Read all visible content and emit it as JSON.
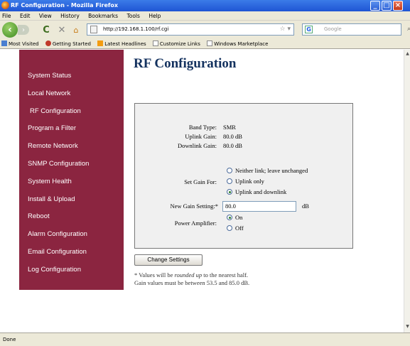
{
  "window": {
    "title": "RF Configuration - Mozilla Firefox"
  },
  "menu": [
    "File",
    "Edit",
    "View",
    "History",
    "Bookmarks",
    "Tools",
    "Help"
  ],
  "nav": {
    "url": "http://192.168.1.100/rf.cgi",
    "search_placeholder": "Google"
  },
  "bookmarks": [
    "Most Visited",
    "Getting Started",
    "Latest Headlines",
    "Customize Links",
    "Windows Marketplace"
  ],
  "sidebar": {
    "items": [
      {
        "label": "System Status"
      },
      {
        "label": "Local Network"
      },
      {
        "label": "RF Configuration"
      },
      {
        "label": "Program a Filter"
      },
      {
        "label": "Remote Network"
      },
      {
        "label": "SNMP Configuration"
      },
      {
        "label": "System Health"
      },
      {
        "label": "Install & Upload"
      },
      {
        "label": "Reboot"
      },
      {
        "label": "Alarm Configuration"
      },
      {
        "label": "Email Configuration"
      },
      {
        "label": "Log Configuration"
      }
    ]
  },
  "page": {
    "title": "RF Configuration"
  },
  "form": {
    "band_type_label": "Band Type:",
    "band_type_value": "SMR",
    "uplink_gain_label": "Uplink Gain:",
    "uplink_gain_value": "80.0 dB",
    "downlink_gain_label": "Downlink Gain:",
    "downlink_gain_value": "80.0 dB",
    "set_gain_label": "Set Gain For:",
    "set_gain_options": [
      {
        "label": "Neither link; leave unchanged",
        "selected": false
      },
      {
        "label": "Uplink only",
        "selected": false
      },
      {
        "label": "Uplink and downlink",
        "selected": true
      }
    ],
    "new_gain_label": "New Gain Setting:*",
    "new_gain_value": "80.0",
    "new_gain_unit": "dB",
    "power_amp_label": "Power Amplifier:",
    "power_amp_options": [
      {
        "label": "On",
        "selected": true
      },
      {
        "label": "Off",
        "selected": false
      }
    ],
    "submit_label": "Change Settings"
  },
  "notes": {
    "line1_prefix": "* Values will be ",
    "line1_em": "rounded up",
    "line1_suffix": " to the nearest half.",
    "line2": "Gain values must be between 53.5 and 85.0 dB."
  },
  "status": {
    "text": "Done"
  }
}
